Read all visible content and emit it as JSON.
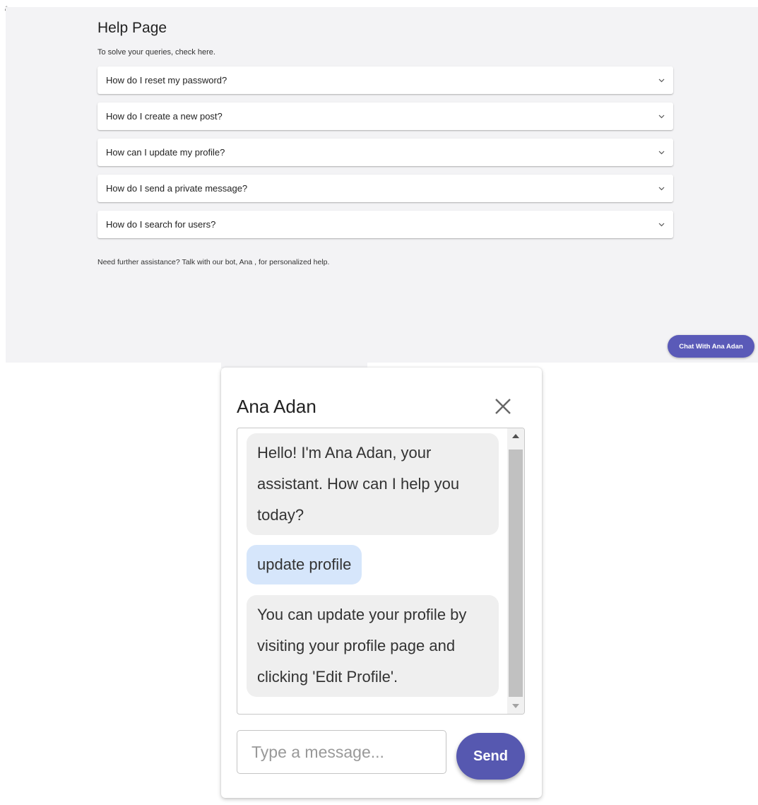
{
  "stray_markup": "/>",
  "help": {
    "title": "Help Page",
    "subtitle": "To solve your queries, check here.",
    "faqs": [
      {
        "question": "How do I reset my password?",
        "icon": "chevron-down-icon"
      },
      {
        "question": "How do I create a new post?",
        "icon": "chevron-down-icon"
      },
      {
        "question": "How can I update my profile?",
        "icon": "chevron-down-icon"
      },
      {
        "question": "How do I send a private message?",
        "icon": "chevron-down-icon"
      },
      {
        "question": "How do I search for users?",
        "icon": "chevron-down-icon"
      }
    ],
    "footer": "Need further assistance? Talk with our bot, Ana , for personalized help."
  },
  "chat_launcher": {
    "label": "Chat With Ana Adan",
    "color": "#5a5ab8"
  },
  "chat": {
    "title": "Ana Adan",
    "close_icon": "close-icon",
    "messages": [
      {
        "sender": "bot",
        "text": "Hello! I'm Ana Adan, your assistant. How can I help you today?"
      },
      {
        "sender": "user",
        "text": "update profile"
      },
      {
        "sender": "bot",
        "text": "You can update your profile by visiting your profile page and clicking 'Edit Profile'."
      }
    ],
    "input": {
      "placeholder": "Type a message...",
      "value": ""
    },
    "send_label": "Send",
    "colors": {
      "bot_bubble": "#efefef",
      "user_bubble": "#d6e6fb",
      "send_button": "#5658b0"
    }
  }
}
